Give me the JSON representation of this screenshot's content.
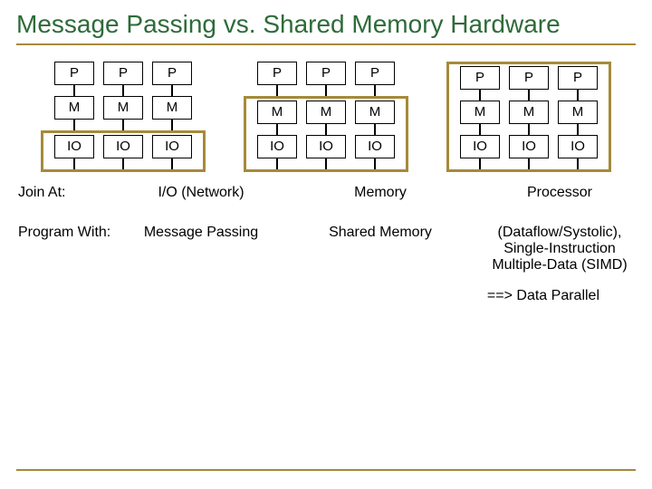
{
  "title": "Message Passing vs. Shared Memory Hardware",
  "box": {
    "p": "P",
    "m": "M",
    "io": "IO"
  },
  "rowLabels": {
    "joinAt": "Join At:",
    "programWith": "Program With:"
  },
  "columns": {
    "c1": {
      "join": "I/O (Network)",
      "prog": "Message Passing"
    },
    "c2": {
      "join": "Memory",
      "prog": "Shared Memory"
    },
    "c3": {
      "join": "Processor",
      "prog": "(Dataflow/Systolic), Single-Instruction Multiple-Data (SIMD)"
    }
  },
  "footer": "==> Data Parallel"
}
